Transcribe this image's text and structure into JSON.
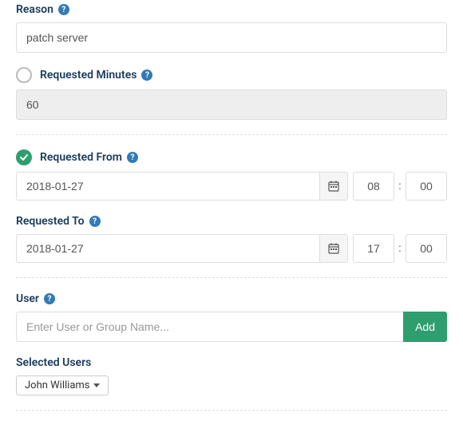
{
  "reason": {
    "label": "Reason",
    "value": "patch server"
  },
  "minutes": {
    "label": "Requested Minutes",
    "value": "60"
  },
  "from": {
    "label": "Requested From",
    "date": "2018-01-27",
    "hour": "08",
    "minute": "00"
  },
  "to": {
    "label": "Requested To",
    "date": "2018-01-27",
    "hour": "17",
    "minute": "00"
  },
  "user": {
    "label": "User",
    "placeholder": "Enter User or Group Name...",
    "add_label": "Add"
  },
  "selected": {
    "label": "Selected Users",
    "items": [
      "John Williams"
    ]
  }
}
